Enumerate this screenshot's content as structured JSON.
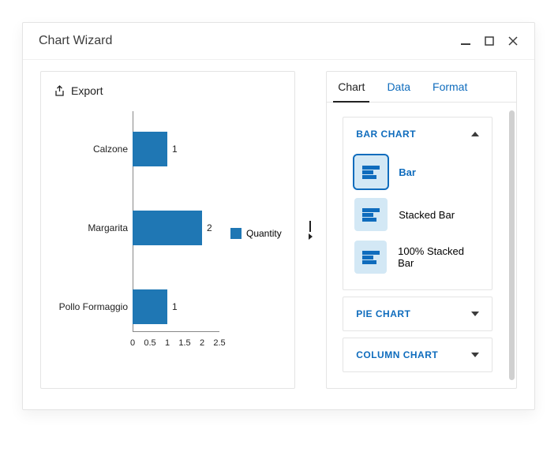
{
  "window": {
    "title": "Chart Wizard"
  },
  "export": {
    "label": "Export"
  },
  "legend": {
    "label": "Quantity"
  },
  "tabs": {
    "chart": "Chart",
    "data": "Data",
    "format": "Format"
  },
  "sections": {
    "bar": {
      "title": "BAR CHART"
    },
    "pie": {
      "title": "PIE CHART"
    },
    "column": {
      "title": "COLUMN CHART"
    }
  },
  "charttypes": {
    "bar": "Bar",
    "stacked": "Stacked Bar",
    "stacked100": "100% Stacked Bar"
  },
  "axis": {
    "ticks": [
      "0",
      "0.5",
      "1",
      "1.5",
      "2",
      "2.5"
    ]
  },
  "colors": {
    "primary": "#0F6CBD",
    "series": "#1F77B4"
  },
  "chart_data": {
    "type": "bar",
    "orientation": "horizontal",
    "categories": [
      "Calzone",
      "Margarita",
      "Pollo Formaggio"
    ],
    "values": [
      1,
      2,
      1
    ],
    "series_name": "Quantity",
    "xlabel": "",
    "ylabel": "",
    "xlim": [
      0,
      2.5
    ],
    "ticks": [
      0,
      0.5,
      1,
      1.5,
      2,
      2.5
    ]
  }
}
